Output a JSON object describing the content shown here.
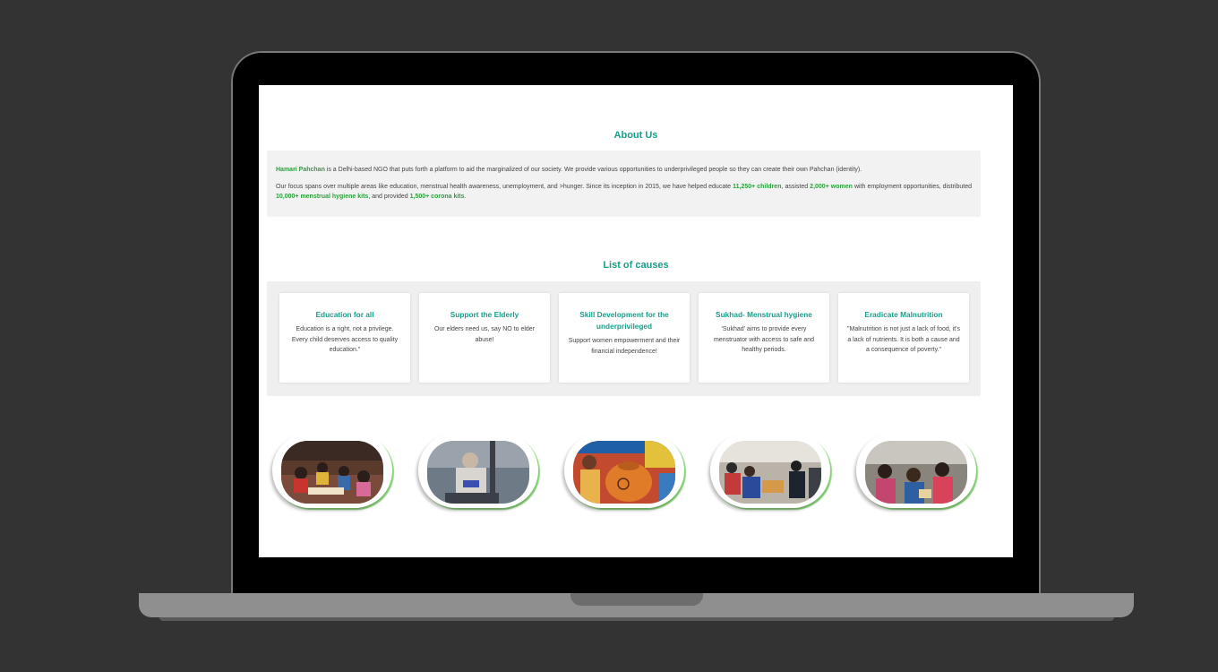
{
  "about": {
    "title": "About Us",
    "org_name": "Hamari Pahchan",
    "p1_rest": " is a Delhi-based NGO that puts forth a platform to aid the marginalized of our society. We provide various opportunities to underprivileged people so they can create their own Pahchan (identity).",
    "p2_a": "Our focus spans over multiple areas like education, menstrual health awareness, unemployment, and >hunger. Since its inception in 2015, we have helped educate ",
    "stat_children": "11,250+ children",
    "p2_b": ", assisted ",
    "stat_women": "2,000+ women",
    "p2_c": " with employment opportunities, distributed ",
    "stat_kits": "10,000+ menstrual hygiene kits",
    "p2_d": ", and provided ",
    "stat_corona": "1,500+ corona kits",
    "p2_e": "."
  },
  "causes": {
    "title": "List of causes",
    "items": [
      {
        "title": "Education for all",
        "desc": "Education is a right, not a privilege. Every child deserves access to quality education.\""
      },
      {
        "title": "Support the Elderly",
        "desc": "Our elders need us, say NO to elder abuse!"
      },
      {
        "title": "Skill Development for the underprivileged",
        "desc": "Support women empowerment and their financial independence!"
      },
      {
        "title": "Sukhad- Menstrual hygiene",
        "desc": "'Sukhad' aims to provide every menstruator with access to safe and healthy periods."
      },
      {
        "title": "Eradicate Malnutrition",
        "desc": "\"Malnutrition is not just a lack of food, it's a lack of nutrients. It is both a cause and a consequence of poverty.\""
      }
    ]
  },
  "colors": {
    "accent_teal": "#1a9e8a",
    "highlight_green": "#2e9e3e",
    "background": "#333333"
  }
}
